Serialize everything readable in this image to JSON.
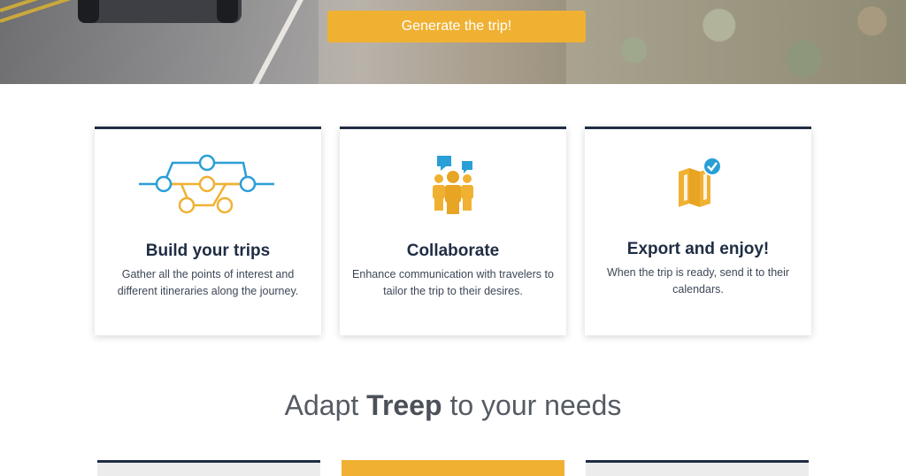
{
  "hero": {
    "cta_label": "Generate the trip!"
  },
  "features": [
    {
      "title": "Build your trips",
      "description": "Gather all the points of interest and different itineraries along the journey.",
      "icon": "route-network-icon"
    },
    {
      "title": "Collaborate",
      "description": "Enhance communication with travelers to tailor the trip to their desires.",
      "icon": "team-chat-icon"
    },
    {
      "title": "Export and enjoy!",
      "description": "When the trip is ready, send it to their calendars.",
      "icon": "map-check-icon"
    }
  ],
  "section": {
    "title_prefix": "Adapt ",
    "title_brand": "Treep",
    "title_suffix": " to your needs"
  },
  "colors": {
    "accent": "#f0b133",
    "dark": "#1f2d44",
    "blue": "#2a9fd6"
  }
}
